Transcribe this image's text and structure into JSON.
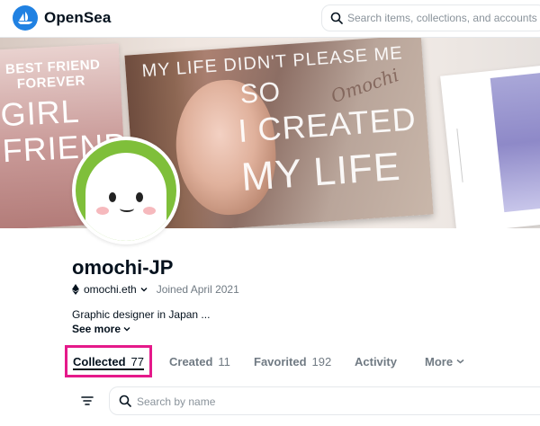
{
  "header": {
    "brand": "OpenSea",
    "logo_icon": "opensea-sailboat-icon",
    "search_placeholder": "Search items, collections, and accounts",
    "accent_color": "#2081e2"
  },
  "banner": {
    "left_card": {
      "line1": "BEST FRIEND",
      "line2": "FOREVER",
      "line3": "GIRL",
      "line4": "FRIEND"
    },
    "center_card": {
      "line1": "MY LIFE DIDN'T PLEASE ME",
      "line2": "SO",
      "line3": "I CREATED",
      "line4": "MY LIFE",
      "signature": "Omochi"
    }
  },
  "profile": {
    "username": "omochi-JP",
    "ens": "omochi.eth",
    "joined": "Joined April 2021",
    "bio": "Graphic designer in Japan ...",
    "see_more": "See more"
  },
  "tabs": [
    {
      "label": "Collected",
      "count": "77",
      "active": true
    },
    {
      "label": "Created",
      "count": "11",
      "active": false
    },
    {
      "label": "Favorited",
      "count": "192",
      "active": false
    },
    {
      "label": "Activity",
      "count": "",
      "active": false
    },
    {
      "label": "More",
      "count": "",
      "active": false
    }
  ],
  "filter": {
    "search_placeholder": "Search by name"
  },
  "colors": {
    "highlight_box": "#e5198a",
    "avatar_bg": "#7fbf3a"
  }
}
